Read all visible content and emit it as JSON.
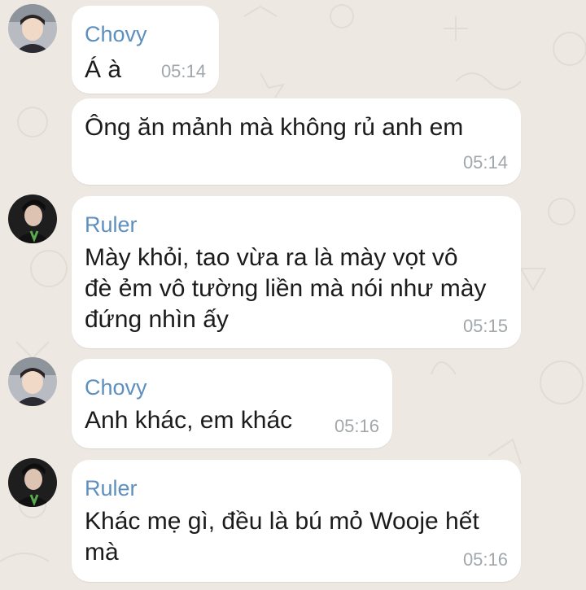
{
  "messages": [
    {
      "sender": "Chovy",
      "text": "Á à",
      "time": "05:14",
      "avatar": "chovy-avatar"
    },
    {
      "sender": "",
      "text": "Ông ăn mảnh mà không rủ anh em",
      "time": "05:14",
      "avatar": ""
    },
    {
      "sender": "Ruler",
      "text": "Mày khỏi, tao vừa ra là mày vọt vô\nđè ẻm vô tường liền mà nói như mày\nđứng nhìn ấy",
      "time": "05:15",
      "avatar": "ruler-avatar"
    },
    {
      "sender": "Chovy",
      "text": "Anh khác, em khác",
      "time": "05:16",
      "avatar": "chovy-avatar"
    },
    {
      "sender": "Ruler",
      "text": "Khác mẹ gì, đều là bú mỏ Wooje hết\nmà",
      "time": "05:16",
      "avatar": "ruler-avatar"
    }
  ],
  "colors": {
    "background": "#ede8e1",
    "bubble": "#ffffff",
    "sender_name": "#5d8fbf",
    "timestamp": "#a2a7ab",
    "message_text": "#1b1b1b"
  }
}
